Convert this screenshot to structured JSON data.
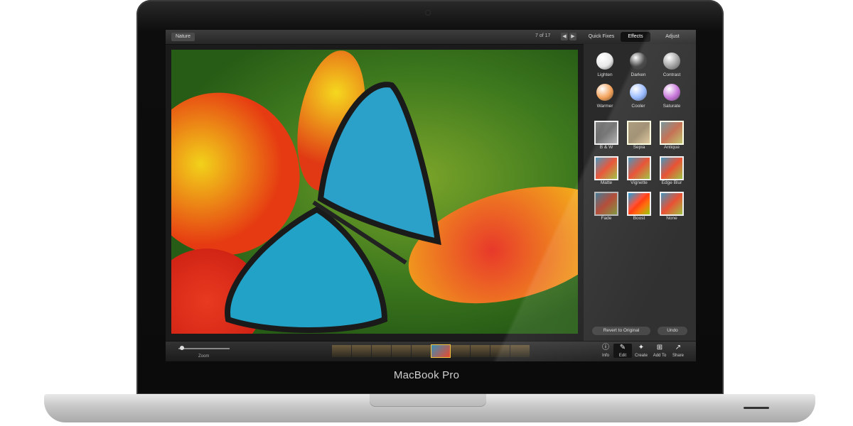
{
  "device": {
    "brand_label": "MacBook Pro"
  },
  "topbar": {
    "album_label": "Nature",
    "counter": "7 of 17",
    "prev_icon": "chevron-left-icon",
    "next_icon": "chevron-right-icon",
    "tabs": [
      {
        "label": "Quick Fixes",
        "active": false
      },
      {
        "label": "Effects",
        "active": true
      },
      {
        "label": "Adjust",
        "active": false
      }
    ]
  },
  "effects": {
    "basic": [
      {
        "label": "Lighten",
        "color": "#e8e8e8"
      },
      {
        "label": "Darken",
        "color": "#3a3a3a"
      },
      {
        "label": "Contrast",
        "color": "#9a9a9a"
      },
      {
        "label": "Warmer",
        "color": "#f3a25a"
      },
      {
        "label": "Cooler",
        "color": "#8fb4ff"
      },
      {
        "label": "Saturate",
        "color": "#c36bd6"
      }
    ],
    "presets": [
      {
        "label": "B & W"
      },
      {
        "label": "Sepia"
      },
      {
        "label": "Antique"
      },
      {
        "label": "Matte"
      },
      {
        "label": "Vignette"
      },
      {
        "label": "Edge Blur"
      },
      {
        "label": "Fade"
      },
      {
        "label": "Boost"
      },
      {
        "label": "None"
      }
    ],
    "revert_label": "Revert to Original",
    "undo_label": "Undo"
  },
  "bottombar": {
    "zoom_label": "Zoom",
    "tools": [
      {
        "label": "Info",
        "icon": "info-icon",
        "glyph": "ⓘ",
        "active": false
      },
      {
        "label": "Edit",
        "icon": "brush-icon",
        "glyph": "✎",
        "active": true
      },
      {
        "label": "Create",
        "icon": "create-icon",
        "glyph": "✦",
        "active": false
      },
      {
        "label": "Add To",
        "icon": "add-icon",
        "glyph": "⊞",
        "active": false
      },
      {
        "label": "Share",
        "icon": "share-icon",
        "glyph": "↗",
        "active": false
      }
    ]
  }
}
